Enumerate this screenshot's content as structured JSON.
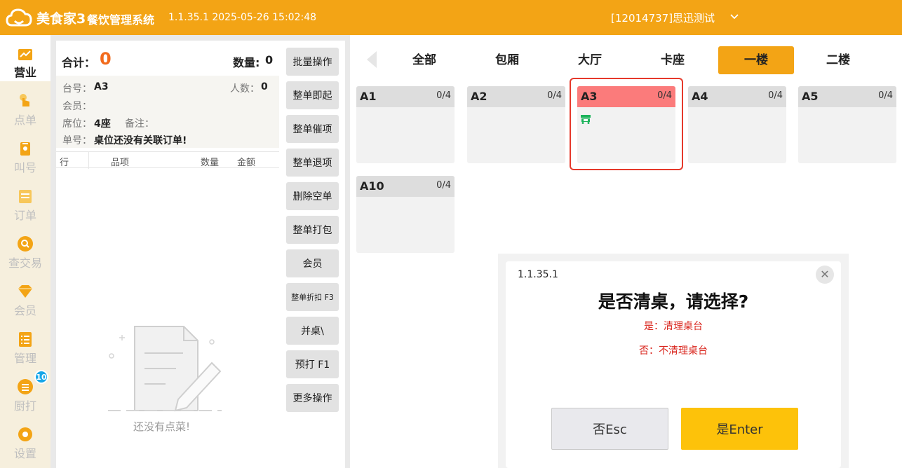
{
  "header": {
    "logo_text": "美食家3",
    "system_name": "餐饮管理系统",
    "version_datetime": "1.1.35.1 2025-05-26 15:02:48",
    "store": "[12014737]思迅测试"
  },
  "sidebar": {
    "items": [
      {
        "label": "营业",
        "icon": "chart-icon",
        "active": true
      },
      {
        "label": "点单",
        "icon": "hand-tap-icon"
      },
      {
        "label": "叫号",
        "icon": "ticket-icon"
      },
      {
        "label": "订单",
        "icon": "list-icon"
      },
      {
        "label": "查交易",
        "icon": "search-icon"
      },
      {
        "label": "会员",
        "icon": "diamond-icon"
      },
      {
        "label": "管理",
        "icon": "checklist-icon"
      },
      {
        "label": "厨打",
        "icon": "menu-circle-icon"
      },
      {
        "label": "设置",
        "icon": "gear-icon"
      }
    ],
    "kitchen_badge": "10"
  },
  "order": {
    "total_label": "合计：",
    "total_value": "0",
    "qty_label": "数量:",
    "qty_value": "0",
    "table_label": "台号：",
    "table_value": "A3",
    "people_label": "人数：",
    "people_value": "0",
    "member_label": "会员：",
    "seat_label": "席位：",
    "seat_value": "4座",
    "remark_label": "备注：",
    "bill_label": "单号：",
    "bill_value": "桌位还没有关联订单!",
    "columns": [
      "行",
      "品项",
      "数量",
      "金额"
    ],
    "empty_text": "还没有点菜!"
  },
  "actions": [
    {
      "label": "批量操作"
    },
    {
      "label": "整单即起"
    },
    {
      "label": "整单催项"
    },
    {
      "label": "整单退项"
    },
    {
      "label": "删除空单"
    },
    {
      "label": "整单打包"
    },
    {
      "label": "会员"
    },
    {
      "label": "整单折扣 F3",
      "small": true
    },
    {
      "label": "并桌\\"
    },
    {
      "label": "预打 F1"
    },
    {
      "label": "更多操作"
    }
  ],
  "areas": {
    "tabs": [
      "全部",
      "包厢",
      "大厅",
      "卡座",
      "一楼",
      "二楼"
    ],
    "active_tab": "一楼"
  },
  "tables": [
    {
      "name": "A1",
      "count": "0/4"
    },
    {
      "name": "A2",
      "count": "0/4"
    },
    {
      "name": "A3",
      "count": "0/4",
      "status": "occupied",
      "icon": "cleaning-cart-icon"
    },
    {
      "name": "A4",
      "count": "0/4"
    },
    {
      "name": "A5",
      "count": "0/4"
    },
    {
      "name": "A10",
      "count": "0/4"
    }
  ],
  "dialog": {
    "version": "1.1.35.1",
    "title": "是否清桌，请选择?",
    "yes_hint": "是：清理桌台",
    "no_hint": "否：不清理桌台",
    "no_button": "否Esc",
    "yes_button": "是Enter"
  },
  "colors": {
    "brand": "#f3a415",
    "total": "#f26b1d",
    "occupied": "#fb7b7b",
    "highlight": "#e5392b",
    "hint_red": "#d9251d",
    "confirm": "#fdc20a",
    "badge": "#16a6e8"
  }
}
